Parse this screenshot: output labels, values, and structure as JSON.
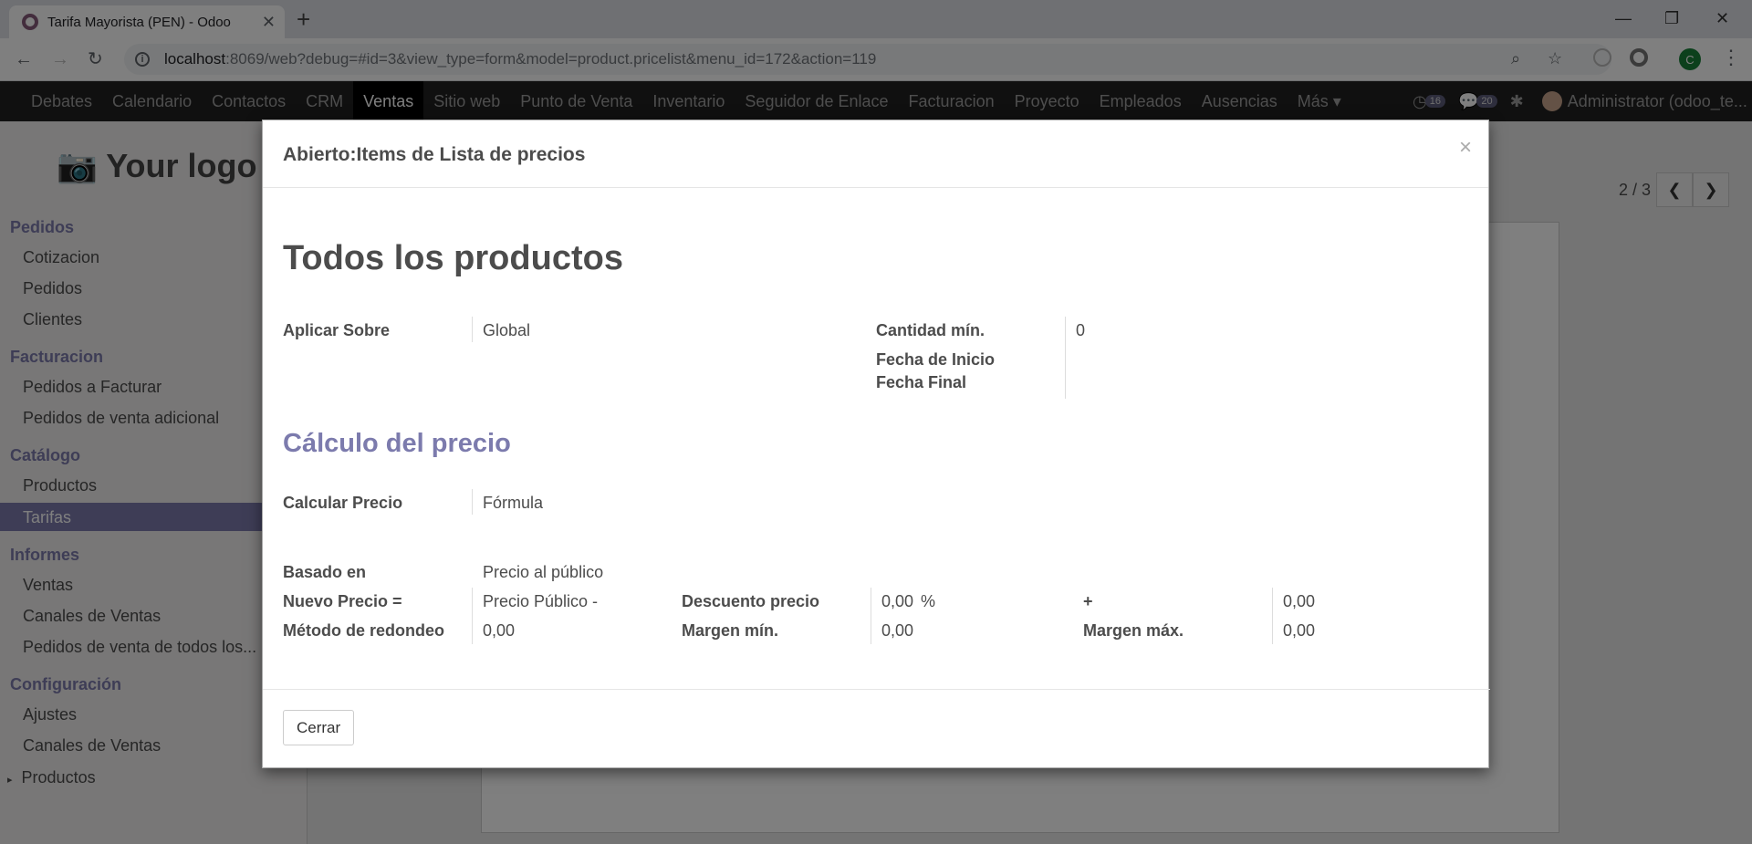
{
  "browser": {
    "tab_title": "Tarifa Mayorista (PEN) - Odoo",
    "url_host": "localhost",
    "url_rest": ":8069/web?debug=#id=3&view_type=form&model=product.pricelist&menu_id=172&action=119",
    "profile_initial": "C"
  },
  "menubar": {
    "items": [
      "Debates",
      "Calendario",
      "Contactos",
      "CRM",
      "Ventas",
      "Sitio web",
      "Punto de Venta",
      "Inventario",
      "Seguidor de Enlace",
      "Facturacion",
      "Proyecto",
      "Empleados",
      "Ausencias",
      "Más"
    ],
    "active": "Ventas",
    "badge_activity": "16",
    "badge_messages": "20",
    "user": "Administrator (odoo_te..."
  },
  "sidebar": {
    "logo": "Your logo",
    "sections": [
      {
        "title": "Pedidos",
        "items": [
          "Cotizacion",
          "Pedidos",
          "Clientes"
        ]
      },
      {
        "title": "Facturacion",
        "items": [
          "Pedidos a Facturar",
          "Pedidos de venta adicional"
        ]
      },
      {
        "title": "Catálogo",
        "items": [
          "Productos",
          "Tarifas"
        ]
      },
      {
        "title": "Informes",
        "items": [
          "Ventas",
          "Canales de Ventas",
          "Pedidos de venta de todos los..."
        ]
      },
      {
        "title": "Configuración",
        "items": [
          "Ajustes",
          "Canales de Ventas",
          "Productos"
        ]
      }
    ],
    "active_item": "Tarifas"
  },
  "pager": {
    "text": "2 / 3"
  },
  "modal": {
    "title": "Abierto:Items de Lista de precios",
    "close_symbol": "×",
    "record_name": "Todos los productos",
    "fields": {
      "aplicar_sobre_label": "Aplicar Sobre",
      "aplicar_sobre_value": "Global",
      "cantidad_min_label": "Cantidad mín.",
      "cantidad_min_value": "0",
      "fecha_inicio_label": "Fecha de Inicio",
      "fecha_final_label": "Fecha Final"
    },
    "section_title": "Cálculo del precio",
    "calc": {
      "calcular_precio_label": "Calcular Precio",
      "calcular_precio_value": "Fórmula",
      "basado_en_label": "Basado en",
      "basado_en_value": "Precio al público",
      "nuevo_precio_label": "Nuevo Precio =",
      "nuevo_precio_value": "Precio Público -",
      "descuento_label": "Descuento precio",
      "descuento_value": "0,00",
      "descuento_unit": "%",
      "plus_label": "+",
      "plus_value": "0,00",
      "redondeo_label": "Método de redondeo",
      "redondeo_value": "0,00",
      "margen_min_label": "Margen mín.",
      "margen_min_value": "0,00",
      "margen_max_label": "Margen máx.",
      "margen_max_value": "0,00"
    },
    "close_button": "Cerrar"
  }
}
